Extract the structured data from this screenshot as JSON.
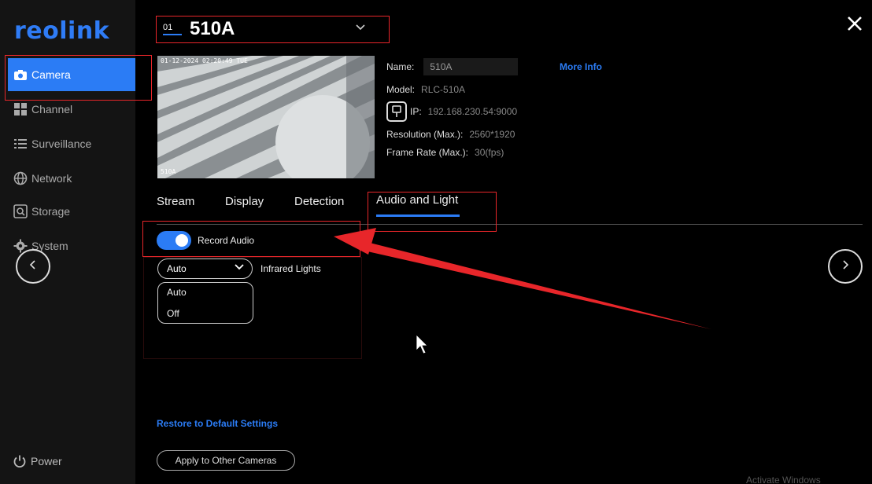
{
  "sidebar": {
    "logo": "reolink",
    "items": [
      {
        "label": "Camera",
        "icon": "camera-icon"
      },
      {
        "label": "Channel",
        "icon": "grid-icon"
      },
      {
        "label": "Surveillance",
        "icon": "list-icon"
      },
      {
        "label": "Network",
        "icon": "globe-icon"
      },
      {
        "label": "Storage",
        "icon": "storage-icon"
      },
      {
        "label": "System",
        "icon": "gear-icon"
      }
    ],
    "power_label": "Power"
  },
  "header": {
    "channel_num": "01",
    "camera_name": "510A",
    "close_icon": "close-icon"
  },
  "preview": {
    "timestamp": "01-12-2024 02:20:49 TUE",
    "label": "510A"
  },
  "info": {
    "name_key": "Name:",
    "name_val": "510A",
    "more_info": "More Info",
    "model_key": "Model:",
    "model_val": "RLC-510A",
    "ip_key": "IP:",
    "ip_val": "192.168.230.54:9000",
    "resolution_key": "Resolution (Max.):",
    "resolution_val": "2560*1920",
    "framerate_key": "Frame Rate (Max.):",
    "framerate_val": "30(fps)"
  },
  "tabs": [
    {
      "label": "Stream"
    },
    {
      "label": "Display"
    },
    {
      "label": "Detection"
    },
    {
      "label": "Audio and Light"
    }
  ],
  "audio": {
    "record_audio_label": "Record Audio",
    "record_audio_on": true
  },
  "lights": {
    "selected": "Auto",
    "label": "Infrared Lights",
    "options": [
      "Auto",
      "Off"
    ]
  },
  "footer": {
    "restore": "Restore to Default Settings",
    "apply": "Apply to Other Cameras"
  },
  "watermark": "Activate Windows",
  "colors": {
    "accent": "#2b7cf5",
    "annotation": "#e8262a"
  }
}
